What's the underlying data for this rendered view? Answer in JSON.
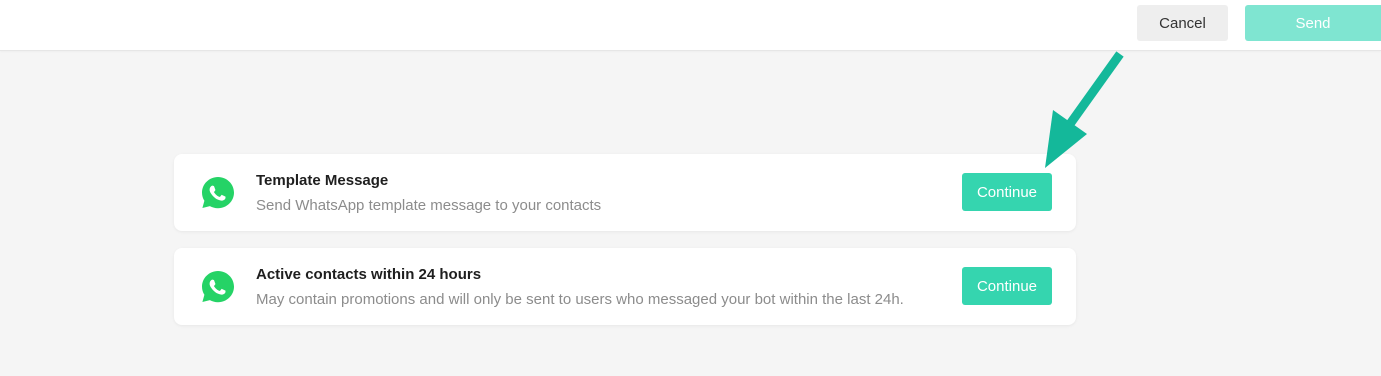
{
  "toolbar": {
    "cancel_label": "Cancel",
    "send_label": "Send"
  },
  "options": [
    {
      "icon": "whatsapp-icon",
      "title": "Template Message",
      "description": "Send WhatsApp template message to your contacts",
      "button_label": "Continue"
    },
    {
      "icon": "whatsapp-icon",
      "title": "Active contacts within 24 hours",
      "description": "May contain promotions and will only be sent to users who messaged your bot within the last 24h.",
      "button_label": "Continue"
    }
  ],
  "colors": {
    "accent": "#35d5af",
    "send_disabled": "#7fe5d1",
    "whatsapp_green": "#25d366",
    "annotation_arrow": "#14b89a"
  }
}
